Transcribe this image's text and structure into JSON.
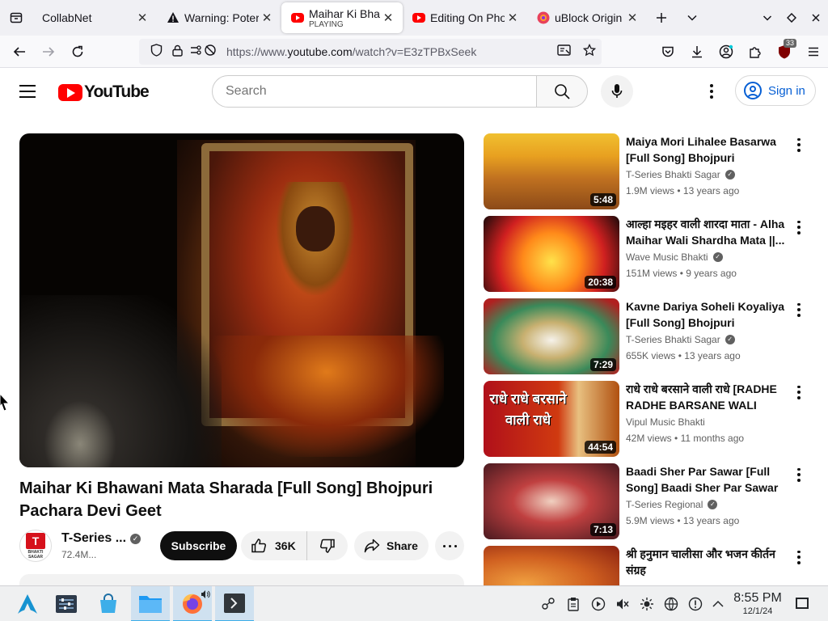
{
  "browser": {
    "tabs": [
      {
        "title": "CollabNet",
        "subtitle": "",
        "active": false
      },
      {
        "title": "Warning: Poter",
        "subtitle": "",
        "active": false
      },
      {
        "title": "Maihar Ki Bhaw",
        "subtitle": "PLAYING",
        "active": true
      },
      {
        "title": "Editing On Pho",
        "subtitle": "",
        "active": false
      },
      {
        "title": "uBlock Origin - ",
        "subtitle": "",
        "active": false
      }
    ],
    "url_host_prefix": "https://www.",
    "url_host": "youtube.com",
    "url_path": "/watch?v=E3zTPBxSeek",
    "extension_badge": "33"
  },
  "youtube": {
    "logo_text": "YouTube",
    "search_placeholder": "Search",
    "sign_in": "Sign in",
    "video": {
      "title": "Maihar Ki Bhawani Mata Sharada [Full Song] Bhojpuri Pachara Devi Geet",
      "channel": "T-Series ...",
      "subscribers": "72.4M...",
      "subscribe": "Subscribe",
      "likes": "36K",
      "share": "Share",
      "avatar_logo": "T",
      "avatar_text": "BHAKTI SAGAR"
    },
    "recommendations": [
      {
        "title": "Maiya Mori Lihalee Basarwa [Full Song] Bhojpuri Pachara...",
        "channel": "T-Series Bhakti Sagar",
        "verified": true,
        "views": "1.9M views",
        "age": "13 years ago",
        "duration": "5:48"
      },
      {
        "title": "आल्हा मइहर वाली शारदा माता - Alha Maihar Wali Shardha Mata ||...",
        "channel": "Wave Music Bhakti",
        "verified": true,
        "views": "151M views",
        "age": "9 years ago",
        "duration": "20:38"
      },
      {
        "title": "Kavne Dariya Soheli Koyaliya [Full Song] Bhojpuri Pachara...",
        "channel": "T-Series Bhakti Sagar",
        "verified": true,
        "views": "655K views",
        "age": "13 years ago",
        "duration": "7:29"
      },
      {
        "title": "राधे राधे बरसाने वाली राधे [RADHE RADHE BARSANE WALI RADH...",
        "channel": "Vipul Music Bhakti",
        "verified": false,
        "views": "42M views",
        "age": "11 months ago",
        "duration": "44:54",
        "thumb_text": "राधे राधे बरसाने वाली राधे"
      },
      {
        "title": "Baadi Sher Par Sawar [Full Song] Baadi Sher Par Sawar",
        "channel": "T-Series Regional",
        "verified": true,
        "views": "5.9M views",
        "age": "13 years ago",
        "duration": "7:13"
      },
      {
        "title": "श्री हनुमान चालीसा और भजन कीर्तन संग्रह",
        "channel": "",
        "verified": false,
        "views": "",
        "age": "",
        "duration": ""
      }
    ]
  },
  "taskbar": {
    "time": "8:55 PM",
    "date": "12/1/24"
  },
  "icons": {
    "tab_list": "tab-list-icon",
    "back": "back-arrow-icon",
    "forward": "forward-arrow-icon",
    "reload": "reload-icon",
    "shield": "tracking-shield-icon",
    "lock": "lock-icon",
    "permissions": "permissions-icon",
    "reader": "reader-view-icon",
    "star": "bookmark-star-icon"
  }
}
